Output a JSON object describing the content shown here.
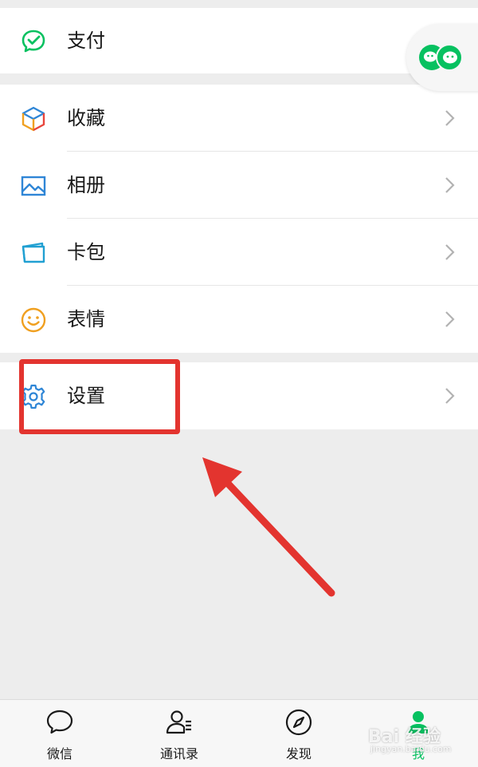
{
  "menu": {
    "pay": "支付",
    "favorites": "收藏",
    "album": "相册",
    "cards": "卡包",
    "stickers": "表情",
    "settings": "设置"
  },
  "tabs": [
    {
      "label": "微信",
      "icon": "chat-bubble-icon",
      "active": false
    },
    {
      "label": "通讯录",
      "icon": "contacts-icon",
      "active": false
    },
    {
      "label": "发现",
      "icon": "compass-icon",
      "active": false
    },
    {
      "label": "我",
      "icon": "person-icon",
      "active": true
    }
  ],
  "watermark": {
    "brand": "Bai 经验",
    "sub": "jingyan.baidu.com"
  },
  "colors": {
    "accent_green": "#07c160",
    "annotation_red": "#e3342f",
    "settings_icon": "#2f86d6",
    "album_icon": "#2f86d6",
    "cards_icon": "#21a0d2",
    "stickers_icon": "#f0a020"
  }
}
